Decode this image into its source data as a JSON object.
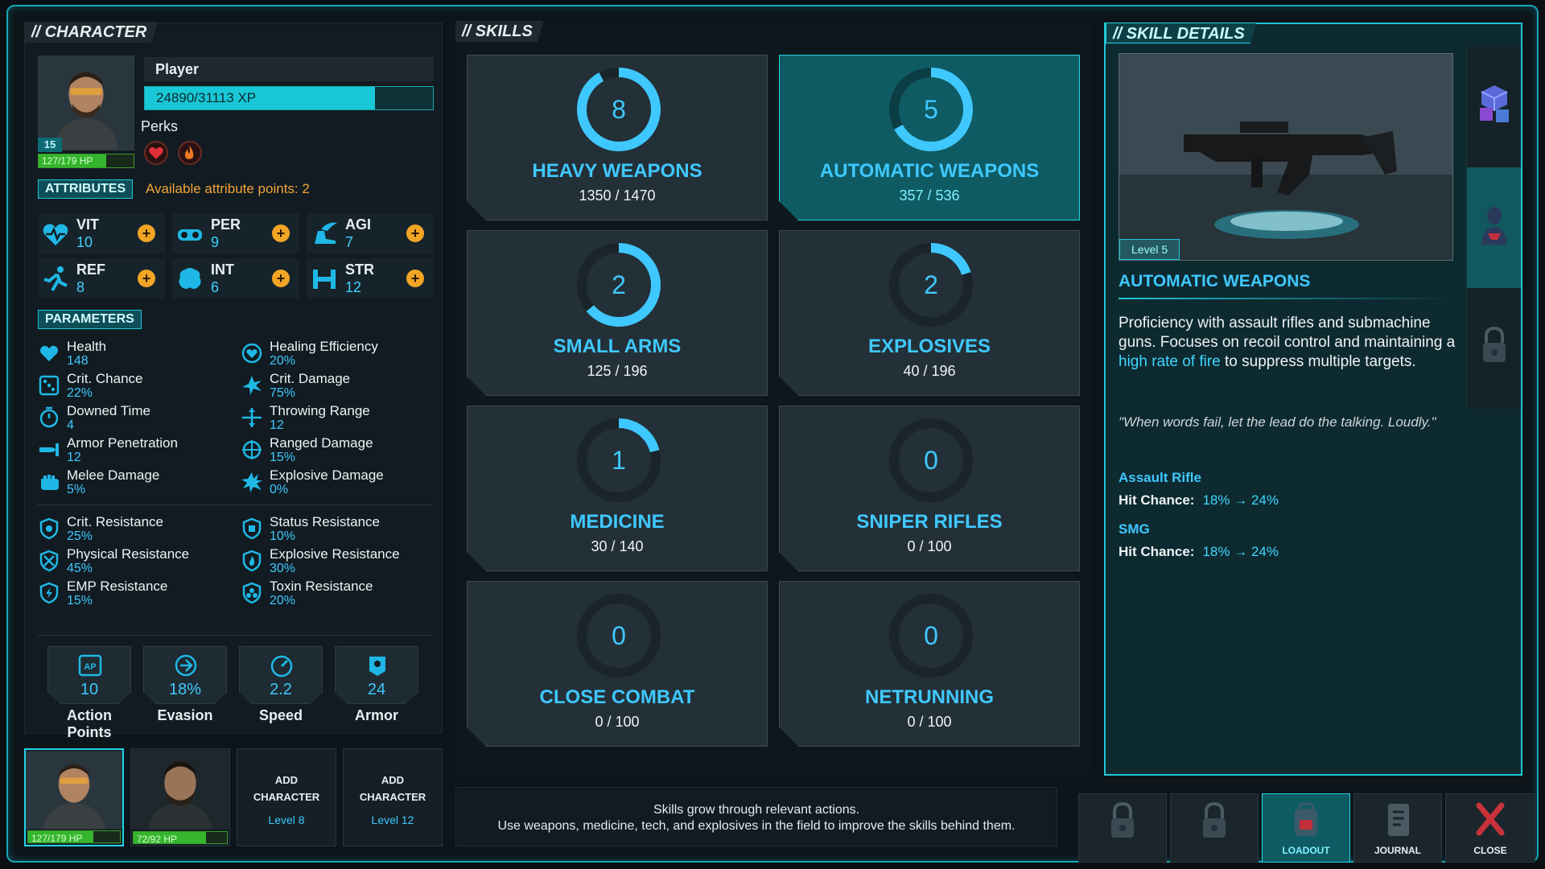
{
  "character": {
    "panel_title": "// CHARACTER",
    "name": "Player",
    "level": "15",
    "hp": "127/179 HP",
    "hp_fraction": 0.71,
    "xp": "24890/31113 XP",
    "xp_fraction": 0.8,
    "perks_label": "Perks",
    "attributes_tag": "ATTRIBUTES",
    "available_points": "Available attribute points: 2",
    "attributes": [
      {
        "name": "VIT",
        "value": "10"
      },
      {
        "name": "PER",
        "value": "9"
      },
      {
        "name": "AGI",
        "value": "7"
      },
      {
        "name": "REF",
        "value": "8"
      },
      {
        "name": "INT",
        "value": "6"
      },
      {
        "name": "STR",
        "value": "12"
      }
    ],
    "plus": "+",
    "parameters_tag": "PARAMETERS",
    "parameters": [
      {
        "name": "Health",
        "value": "148"
      },
      {
        "name": "Healing Efficiency",
        "value": "20%"
      },
      {
        "name": "Crit. Chance",
        "value": "22%"
      },
      {
        "name": "Crit. Damage",
        "value": "75%"
      },
      {
        "name": "Downed Time",
        "value": "4"
      },
      {
        "name": "Throwing Range",
        "value": "12"
      },
      {
        "name": "Armor Penetration",
        "value": "12"
      },
      {
        "name": "Ranged Damage",
        "value": "15%"
      },
      {
        "name": "Melee Damage",
        "value": "5%"
      },
      {
        "name": "Explosive Damage",
        "value": "0%"
      }
    ],
    "resistances": [
      {
        "name": "Crit. Resistance",
        "value": "25%"
      },
      {
        "name": "Status Resistance",
        "value": "10%"
      },
      {
        "name": "Physical Resistance",
        "value": "45%"
      },
      {
        "name": "Explosive Resistance",
        "value": "30%"
      },
      {
        "name": "EMP Resistance",
        "value": "15%"
      },
      {
        "name": "Toxin Resistance",
        "value": "20%"
      }
    ],
    "stats": [
      {
        "label": "Action Points",
        "value": "10"
      },
      {
        "label": "Evasion",
        "value": "18%"
      },
      {
        "label": "Speed",
        "value": "2.2"
      },
      {
        "label": "Armor",
        "value": "24"
      }
    ]
  },
  "roster": [
    {
      "hp": "127/179 HP",
      "hp_fraction": 0.71
    },
    {
      "hp": "72/92 HP",
      "hp_fraction": 0.78
    }
  ],
  "add_slots": [
    {
      "line1": "ADD",
      "line2": "CHARACTER",
      "level": "Level 8"
    },
    {
      "line1": "ADD",
      "line2": "CHARACTER",
      "level": "Level 12"
    }
  ],
  "skills": {
    "panel_title": "// SKILLS",
    "items": [
      {
        "name": "HEAVY WEAPONS",
        "level": "8",
        "progress": "1350 / 1470",
        "ring_fraction": 0.92
      },
      {
        "name": "AUTOMATIC WEAPONS",
        "level": "5",
        "progress": "357 / 536",
        "ring_fraction": 0.67
      },
      {
        "name": "SMALL ARMS",
        "level": "2",
        "progress": "125 / 196",
        "ring_fraction": 0.64
      },
      {
        "name": "EXPLOSIVES",
        "level": "2",
        "progress": "40 / 196",
        "ring_fraction": 0.2
      },
      {
        "name": "MEDICINE",
        "level": "1",
        "progress": "30 / 140",
        "ring_fraction": 0.21
      },
      {
        "name": "SNIPER RIFLES",
        "level": "0",
        "progress": "0 / 100",
        "ring_fraction": 0
      },
      {
        "name": "CLOSE COMBAT",
        "level": "0",
        "progress": "0 / 100",
        "ring_fraction": 0
      },
      {
        "name": "NETRUNNING",
        "level": "0",
        "progress": "0 / 100",
        "ring_fraction": 0
      }
    ],
    "selected_index": 1,
    "note_line1": "Skills grow through relevant actions.",
    "note_line2": "Use weapons, medicine, tech, and explosives in the field to improve the skills behind them."
  },
  "details": {
    "panel_title": "// SKILL DETAILS",
    "level_tag": "Level 5",
    "title": "AUTOMATIC WEAPONS",
    "desc_part1": "Proficiency with assault rifles and submachine guns. Focuses on recoil control and maintaining a ",
    "desc_highlight": "high rate of fire",
    "desc_part2": " to suppress multiple targets.",
    "quote": "\"When words fail, let the lead do the talking. Loudly.\"",
    "weapons": [
      {
        "name": "Assault Rifle",
        "stat_label": "Hit Chance:",
        "stat_value": "18% → 24%"
      },
      {
        "name": "SMG",
        "stat_label": "Hit Chance:",
        "stat_value": "18% → 24%"
      }
    ]
  },
  "nav": {
    "loadout": "LOADOUT",
    "journal": "JOURNAL",
    "close": "CLOSE"
  },
  "colors": {
    "accent": "#1fc6d6",
    "skill_blue": "#3fc8ff",
    "attribute_points": "#f0a43a",
    "hp_green": "#35b52d"
  }
}
